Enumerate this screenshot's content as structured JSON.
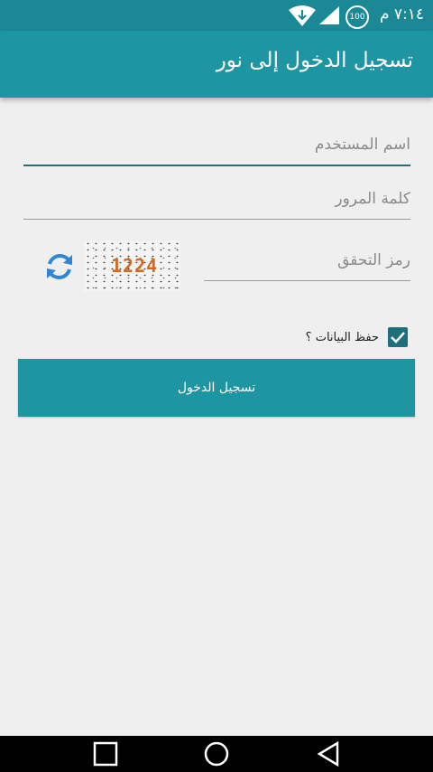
{
  "status_bar": {
    "time": "٧:١٤ م",
    "battery": "100",
    "icons": [
      "wifi-icon",
      "signal-icon",
      "battery-icon"
    ]
  },
  "app_bar": {
    "title": "تسجيل الدخول إلى نور"
  },
  "form": {
    "username_placeholder": "اسم المستخدم",
    "password_placeholder": "كلمة المرور",
    "captcha_placeholder": "رمز التحقق",
    "captcha_code": "1224",
    "remember_label": "حفظ البيانات ؟",
    "remember_checked": true,
    "login_label": "تسجيل الدخول"
  },
  "nav_bar": {
    "icons": [
      "recents-icon",
      "home-icon",
      "back-icon"
    ]
  },
  "colors": {
    "status_bar": "#1b8895",
    "primary": "#1d95a3",
    "accent": "#1d6f7b",
    "background": "#efefef",
    "refresh_icon": "#2f86d1",
    "captcha_text": "#d2691e"
  }
}
